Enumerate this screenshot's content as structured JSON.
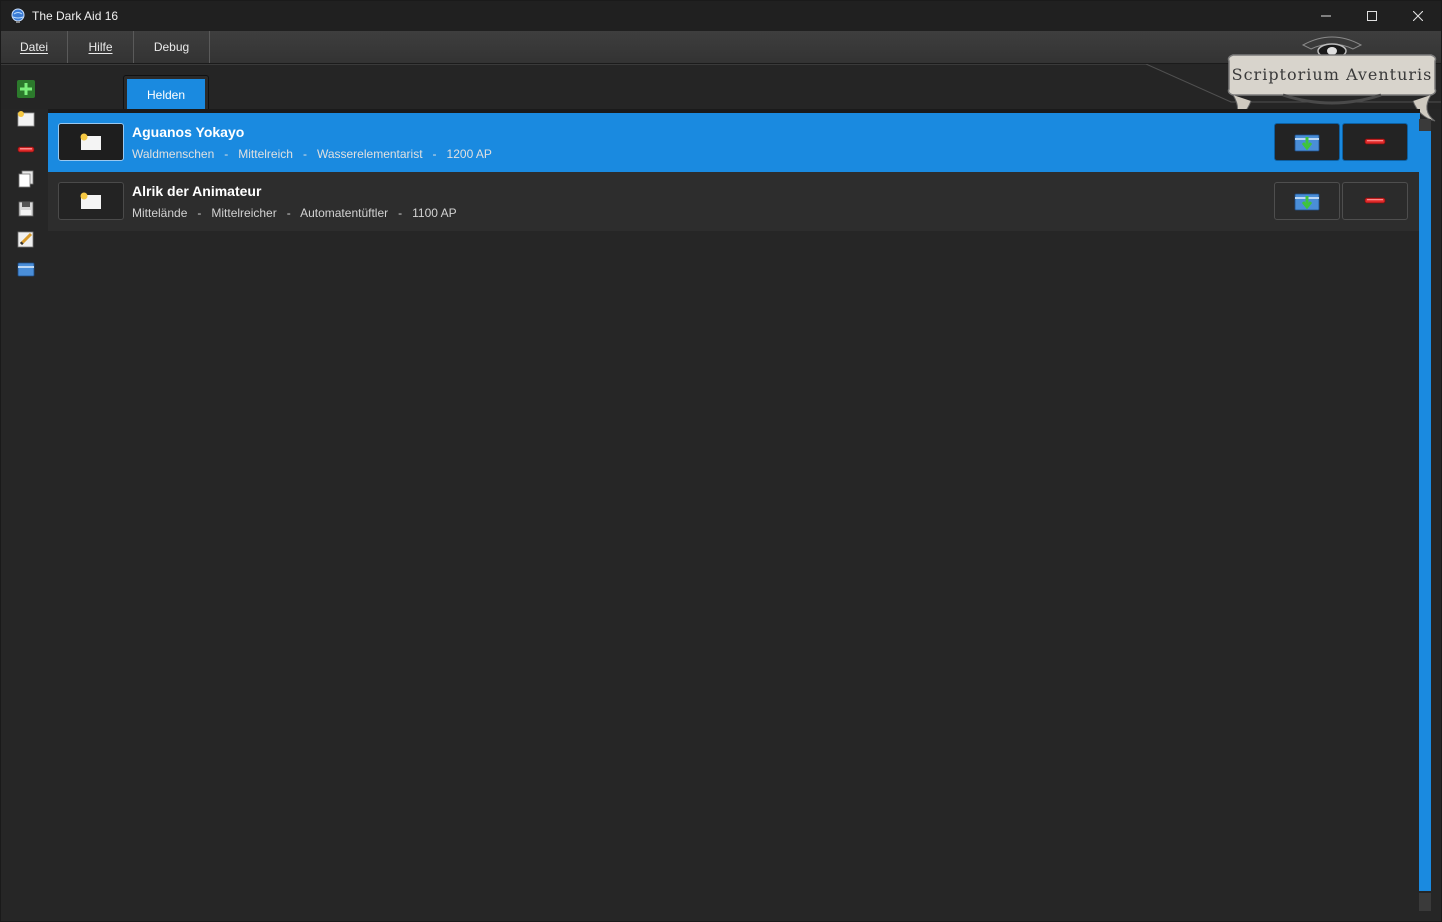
{
  "window": {
    "title": "The Dark Aid 16"
  },
  "menu": {
    "items": [
      {
        "label": "Datei",
        "underline": "D"
      },
      {
        "label": "Hilfe",
        "underline": "H"
      },
      {
        "label": "Debug"
      }
    ]
  },
  "logo": {
    "text": "Scriptorium Aventuris"
  },
  "toolbar": {
    "icons": [
      "add-hero-icon",
      "new-folder-icon",
      "delete-icon",
      "copy-icon",
      "save-icon",
      "edit-icon",
      "open-folder-icon"
    ]
  },
  "tabs": [
    {
      "label": "Helden",
      "active": true
    }
  ],
  "heroes": [
    {
      "name": "Aguanos Yokayo",
      "culture": "Waldmenschen",
      "origin": "Mittelreich",
      "profession": "Wasserelementarist",
      "ap": "1200 AP",
      "selected": true
    },
    {
      "name": "Alrik der Animateur",
      "culture": "Mittelände",
      "origin": "Mittelreicher",
      "profession": "Automatentüftler",
      "ap": "1100 AP",
      "selected": false
    }
  ],
  "colors": {
    "accent": "#1a8ae0",
    "background": "#262626",
    "titlebar": "#202020"
  }
}
